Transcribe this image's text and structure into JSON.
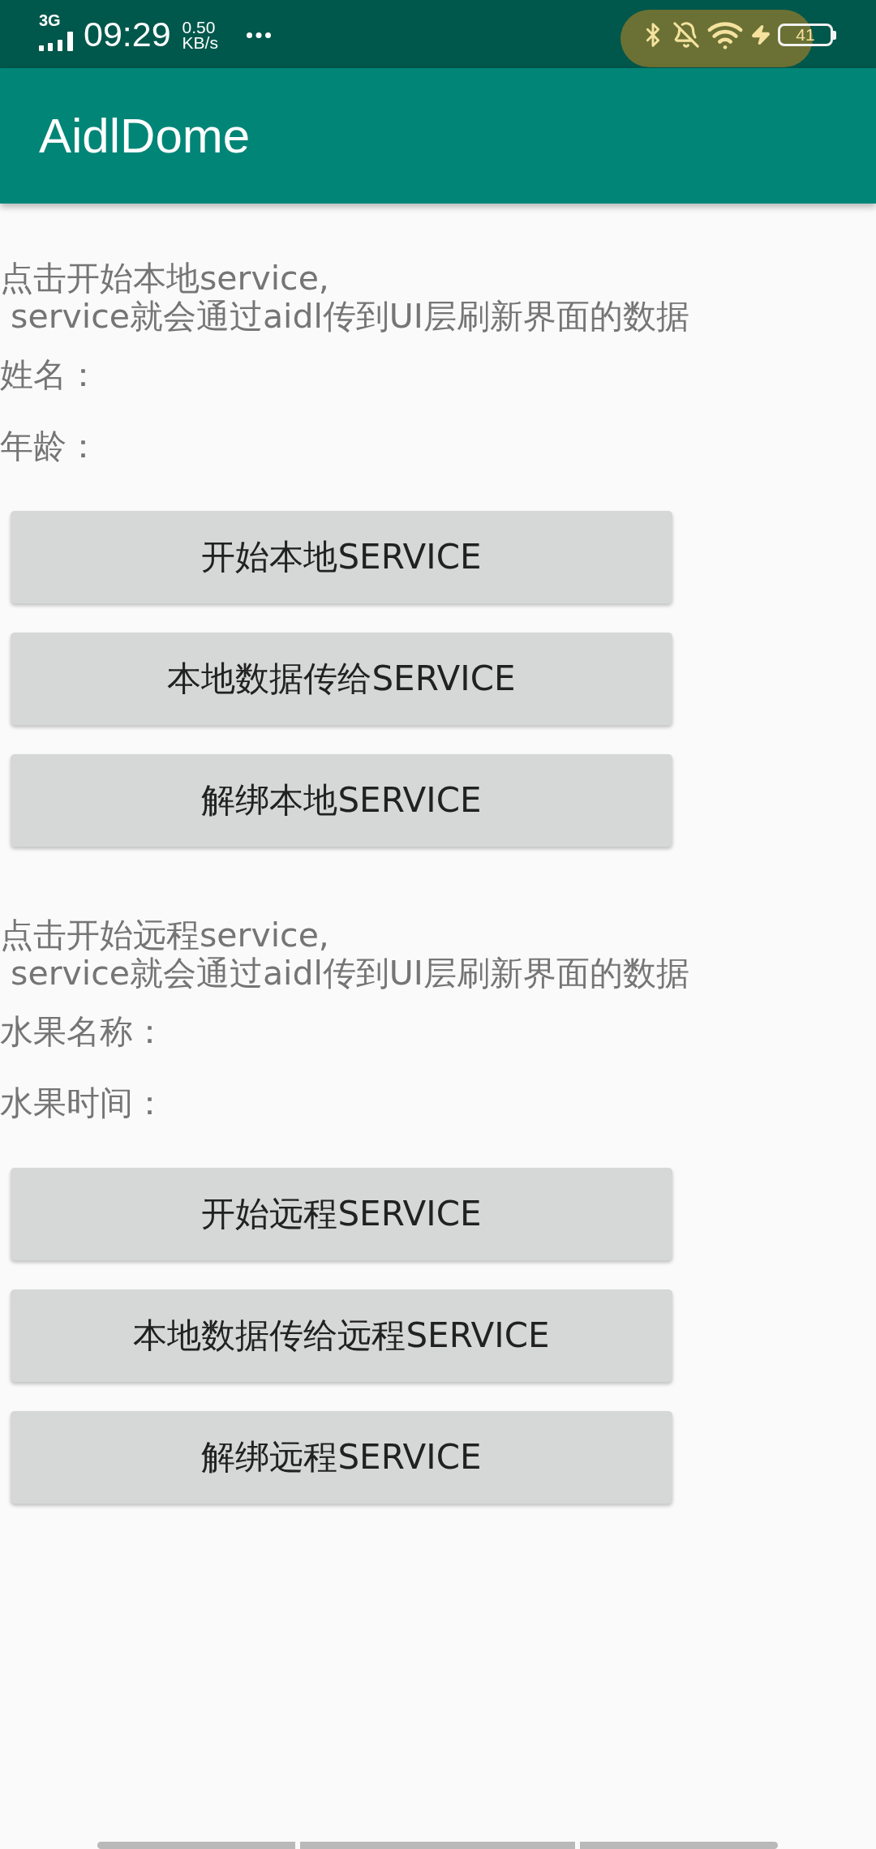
{
  "status_bar": {
    "network_type": "3G",
    "time": "09:29",
    "data_speed": {
      "value": "0.50",
      "unit": "KB/s"
    },
    "battery": "41"
  },
  "app_bar": {
    "title": "AidlDome"
  },
  "sections": [
    {
      "intro": "点击开始本地service,\n service就会通过aidl传到UI层刷新界面的数据",
      "labels": [
        "姓名：",
        "年龄："
      ],
      "buttons": [
        "开始本地SERVICE",
        "本地数据传给SERVICE",
        "解绑本地SERVICE"
      ]
    },
    {
      "intro": "点击开始远程service,\n service就会通过aidl传到UI层刷新界面的数据",
      "labels": [
        "水果名称：",
        "水果时间："
      ],
      "buttons": [
        "开始远程SERVICE",
        "本地数据传给远程SERVICE",
        "解绑远程SERVICE"
      ]
    }
  ]
}
